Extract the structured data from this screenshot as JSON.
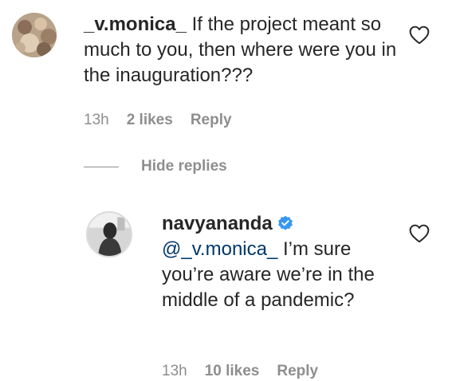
{
  "comments": [
    {
      "username": "_v.monica_",
      "text": "If the project meant so much to you, then where were you in the inauguration???",
      "time": "13h",
      "likes": "2 likes",
      "reply_label": "Reply"
    }
  ],
  "replies_toggle": {
    "label": "Hide replies"
  },
  "replies": [
    {
      "username": "navyananda",
      "verified": true,
      "mention": "@_v.monica_",
      "text": "I’m sure you’re aware we’re in the middle of a pandemic?",
      "time": "13h",
      "likes": "10 likes",
      "reply_label": "Reply"
    }
  ],
  "icons": {
    "like": "heart-outline-icon",
    "verified": "verified-badge-icon"
  },
  "colors": {
    "text": "#262626",
    "muted": "#8e8e8e",
    "mention": "#00376b",
    "verified": "#3897f0"
  }
}
